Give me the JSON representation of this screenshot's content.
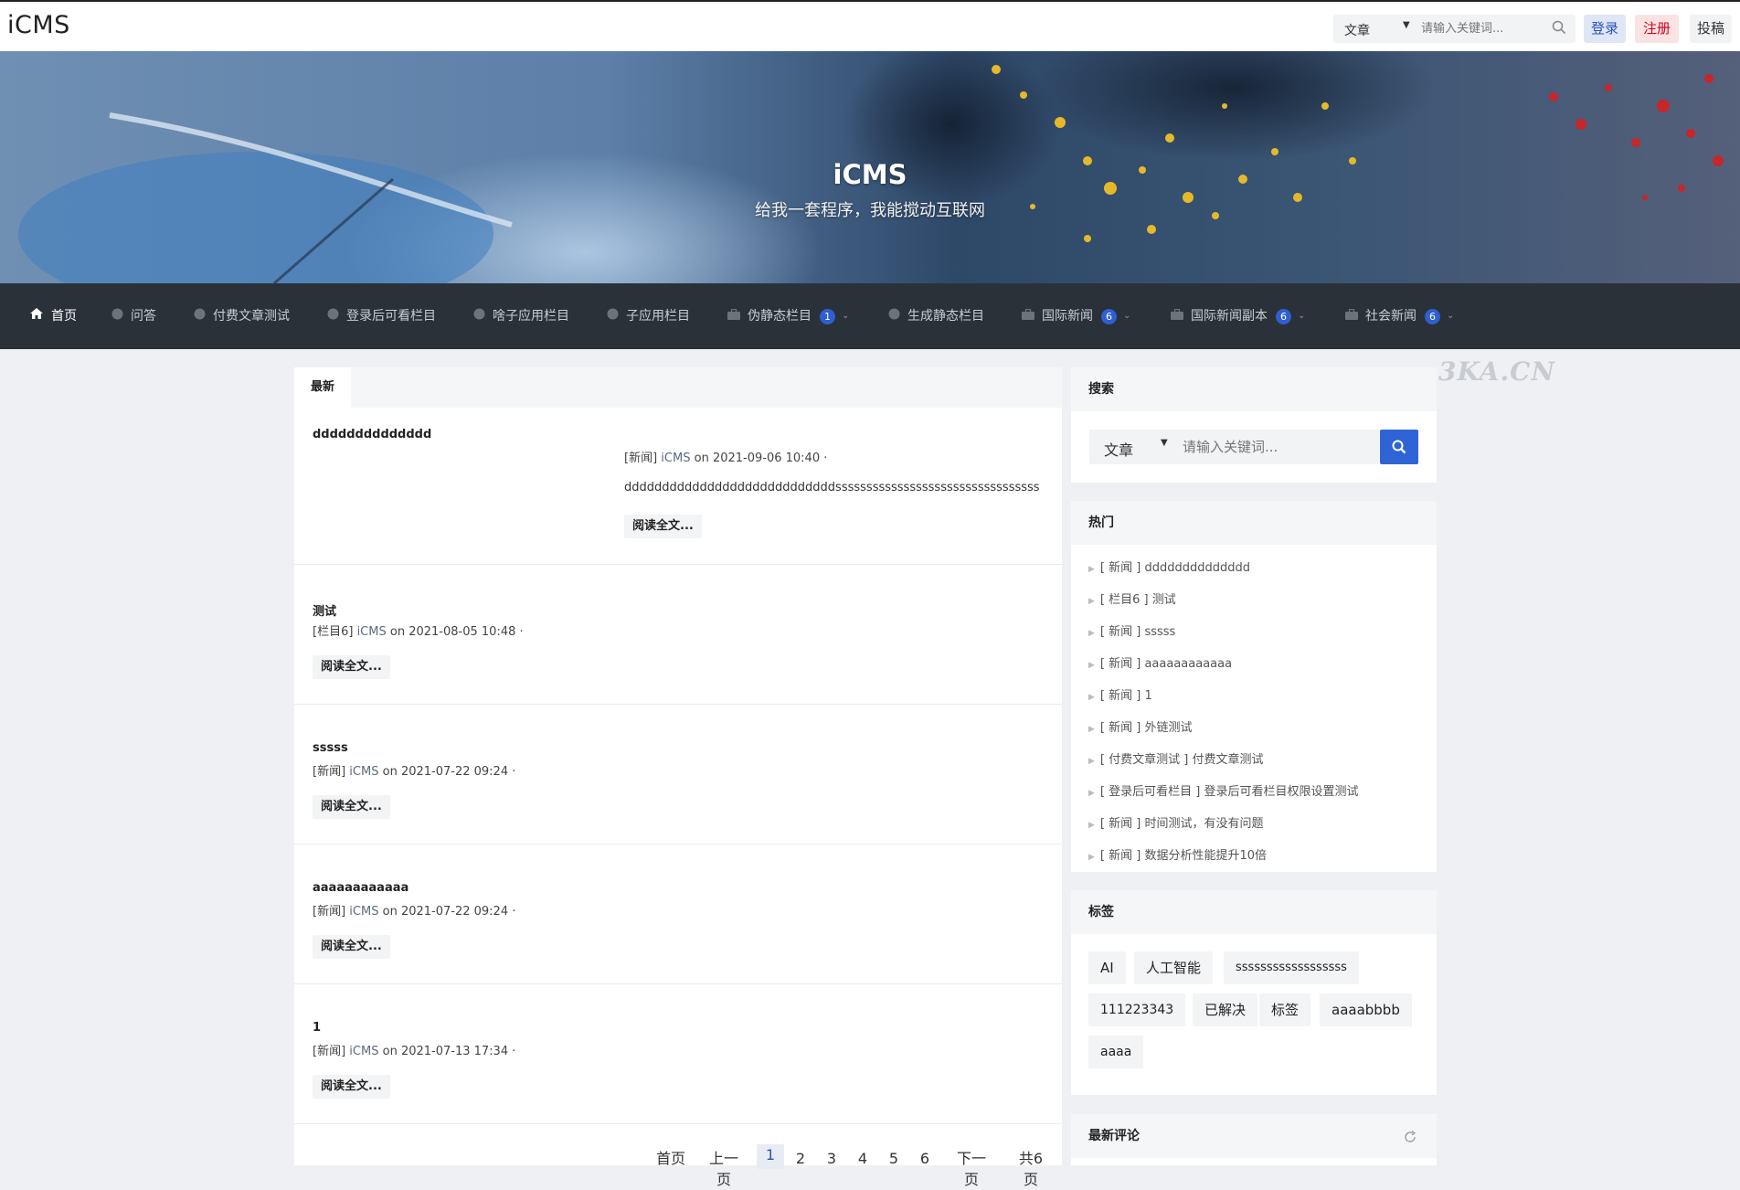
{
  "topbar": {
    "brand": "iCMS",
    "search_type": "文章",
    "search_placeholder": "请输入关键词...",
    "login": "登录",
    "register": "注册",
    "contribute": "投稿"
  },
  "banner": {
    "title": "iCMS",
    "subtitle": "给我一套程序，我能搅动互联网"
  },
  "nav": {
    "items": [
      {
        "label": "首页",
        "badge": ""
      },
      {
        "label": "问答",
        "badge": ""
      },
      {
        "label": "付费文章测试",
        "badge": ""
      },
      {
        "label": "登录后可看栏目",
        "badge": ""
      },
      {
        "label": "啥子应用栏目",
        "badge": ""
      },
      {
        "label": "子应用栏目",
        "badge": ""
      },
      {
        "label": "伪静态栏目",
        "badge": "1"
      },
      {
        "label": "生成静态栏目",
        "badge": ""
      },
      {
        "label": "国际新闻",
        "badge": "6"
      },
      {
        "label": "国际新闻副本",
        "badge": "6"
      },
      {
        "label": "社会新闻",
        "badge": "6"
      }
    ]
  },
  "main": {
    "tab": "最新",
    "read_more": "阅读全文...",
    "articles": [
      {
        "title": "dddddddddddddd",
        "category": "[新闻]",
        "author": "iCMS",
        "on": "on",
        "date": "2021-09-06 10:40",
        "sep": "·",
        "desc": "ddddddddddddddddddddddddddddsssssssssssssssssssssssssssssssss"
      },
      {
        "title": "测试",
        "category": "[栏目6]",
        "author": "iCMS",
        "on": "on",
        "date": "2021-08-05 10:48",
        "sep": "·"
      },
      {
        "title": "sssss",
        "category": "[新闻]",
        "author": "iCMS",
        "on": "on",
        "date": "2021-07-22 09:24",
        "sep": "·"
      },
      {
        "title": "aaaaaaaaaaaa",
        "category": "[新闻]",
        "author": "iCMS",
        "on": "on",
        "date": "2021-07-22 09:24",
        "sep": "·"
      },
      {
        "title": "1",
        "category": "[新闻]",
        "author": "iCMS",
        "on": "on",
        "date": "2021-07-13 17:34",
        "sep": "·"
      }
    ],
    "pager": {
      "first": "首页",
      "prev": "上一页",
      "pages": [
        "1",
        "2",
        "3",
        "4",
        "5",
        "6"
      ],
      "current": "1",
      "next": "下一页",
      "total": "共6页"
    }
  },
  "sidebar": {
    "search": {
      "title": "搜索",
      "type": "文章",
      "placeholder": "请输入关键词..."
    },
    "hot": {
      "title": "热门",
      "items": [
        "[ 新闻 ] dddddddddddddd",
        "[ 栏目6 ] 测试",
        "[ 新闻 ] sssss",
        "[ 新闻 ] aaaaaaaaaaaa",
        "[ 新闻 ] 1",
        "[ 新闻 ] 外链测试",
        "[ 付费文章测试 ] 付费文章测试",
        "[ 登录后可看栏目 ] 登录后可看栏目权限设置测试",
        "[ 新闻 ] 时间测试，有没有问题",
        "[ 新闻 ] 数据分析性能提升10倍"
      ]
    },
    "tags": {
      "title": "标签",
      "items": [
        "AI",
        "人工智能",
        "ssssssssssssssssss",
        "111223343",
        "已解决",
        "标签",
        "aaaabbbb",
        "aaaa"
      ]
    },
    "comments": {
      "title": "最新评论"
    }
  },
  "watermark": "3KA.CN",
  "colors": {
    "nav_bg": "#2a3138",
    "accent": "#2f64d6",
    "badge": "#2f5fd0",
    "register": "#d0021b"
  }
}
